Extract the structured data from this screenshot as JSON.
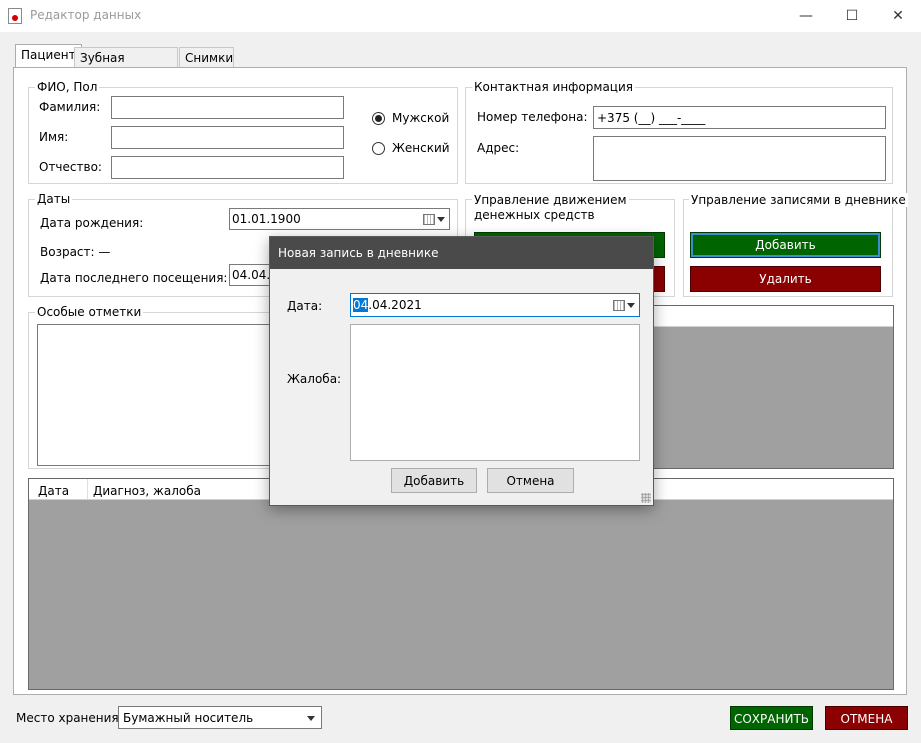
{
  "window": {
    "title": "Редактор данных",
    "minimize_icon": "—",
    "maximize_icon": "☐",
    "close_icon": "✕"
  },
  "tabs": [
    {
      "label": "Пациент",
      "active": true
    },
    {
      "label": "Зубная формула",
      "active": false
    },
    {
      "label": "Снимки",
      "active": false
    }
  ],
  "fio_group": {
    "title": "ФИО, Пол",
    "last_name_label": "Фамилия:",
    "last_name_value": "",
    "first_name_label": "Имя:",
    "first_name_value": "",
    "patronymic_label": "Отчество:",
    "patronymic_value": "",
    "male_label": "Мужской",
    "female_label": "Женский",
    "selected_gender": "Мужской"
  },
  "contact_group": {
    "title": "Контактная информация",
    "phone_label": "Номер телефона:",
    "phone_value": "+375 (__) ___-____",
    "address_label": "Адрес:",
    "address_value": ""
  },
  "dates_group": {
    "title": "Даты",
    "birth_label": "Дата рождения:",
    "birth_value": "01.01.1900",
    "age_label": "Возраст: —",
    "last_visit_label": "Дата последнего посещения:",
    "last_visit_value": "04.04.2021"
  },
  "money_group": {
    "title_line1": "Управление движением",
    "title_line2": "денежных средств"
  },
  "diary_group": {
    "title": "Управление записями в дневнике",
    "add_label": "Добавить",
    "delete_label": "Удалить"
  },
  "notes_group": {
    "title": "Особые отметки",
    "value": ""
  },
  "diary_table": {
    "columns": [
      "Дата",
      "Диагноз, жалоба"
    ],
    "rows": []
  },
  "footer": {
    "storage_label": "Место хранения:",
    "storage_value": "Бумажный носитель",
    "save_label": "СОХРАНИТЬ",
    "cancel_label": "ОТМЕНА"
  },
  "dialog": {
    "title": "Новая запись в дневнике",
    "date_label": "Дата:",
    "date_selected": "04",
    "date_rest": ".04.2021",
    "complaint_label": "Жалоба:",
    "complaint_value": "",
    "add_label": "Добавить",
    "cancel_label": "Отмена"
  },
  "colors": {
    "green_button": "#006400",
    "red_button": "#8b0000",
    "grid_background": "#a0a0a0",
    "dialog_title": "#4a4a4a",
    "selection": "#0078d7"
  }
}
